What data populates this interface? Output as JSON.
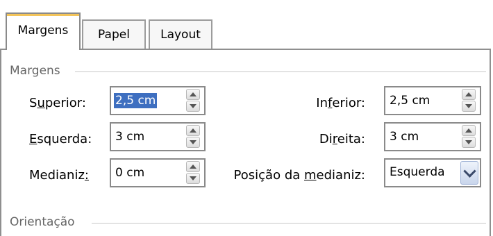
{
  "tabs": [
    {
      "label": "Margens",
      "active": true
    },
    {
      "label": "Papel",
      "active": false
    },
    {
      "label": "Layout",
      "active": false
    }
  ],
  "groups": {
    "margins": "Margens",
    "orientation": "Orientação"
  },
  "fields": {
    "top": {
      "label_pre": "S",
      "label_ul": "u",
      "label_post": "perior:",
      "value": "2,5 cm"
    },
    "bottom": {
      "label_pre": "In",
      "label_ul": "f",
      "label_post": "erior:",
      "value": "2,5 cm"
    },
    "left": {
      "label_pre": "",
      "label_ul": "E",
      "label_post": "squerda:",
      "value": "3 cm"
    },
    "right": {
      "label_pre": "Di",
      "label_ul": "r",
      "label_post": "eita:",
      "value": "3 cm"
    },
    "gutter": {
      "label_pre": "Medianiz",
      "label_ul": ":",
      "label_post": "",
      "value": "0 cm"
    },
    "gutter_position": {
      "label_pre": "Posição da ",
      "label_ul": "m",
      "label_post": "edianiz:",
      "value": "Esquerda"
    }
  },
  "icons": {
    "spin_up": "triangle-up",
    "spin_down": "triangle-down",
    "dropdown": "chevron-down"
  },
  "colors": {
    "selection": "#3e6fc0",
    "active_tab_highlight": "#f3c45a"
  }
}
